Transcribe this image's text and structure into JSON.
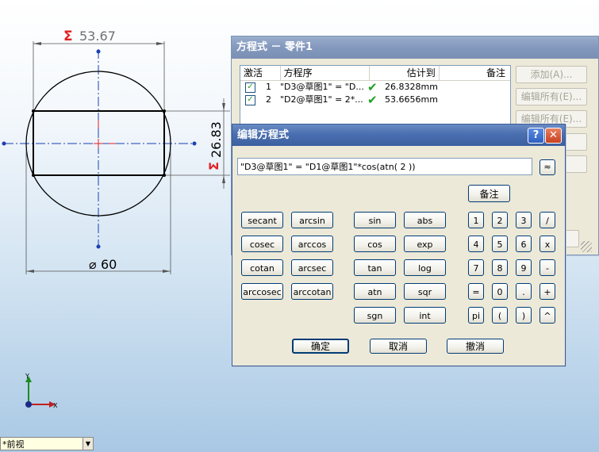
{
  "sketch": {
    "dim_top": "53.67",
    "dim_right": "26.83",
    "dim_bottom": "60",
    "sigma": "Σ",
    "diameter": "⌀"
  },
  "triad": {
    "x_label": "X",
    "y_label": "Y"
  },
  "equations_dialog": {
    "title": "方程式 － 零件1",
    "headers": [
      "激活",
      "方程序",
      "估计到",
      "备注"
    ],
    "rows": [
      {
        "num": "1",
        "equation": "\"D3@草图1\" = \"D...",
        "value": "26.8328mm",
        "active": true
      },
      {
        "num": "2",
        "equation": "\"D2@草图1\" = 2*...",
        "value": "53.6656mm",
        "active": true
      }
    ],
    "buttons": {
      "add": "添加(A)...",
      "edit_all": "编辑所有(E)...",
      "edit_all2": "编辑所有(E)..."
    }
  },
  "edit_dialog": {
    "title": "编辑方程式",
    "help_label": "?",
    "close_label": "✕",
    "expression": "\"D3@草图1\" = \"D1@草图1\"*cos(atn( 2 ))",
    "collapse_label": "≈",
    "note_button": "备注",
    "trig_buttons": [
      "secant",
      "arcsin",
      "cosec",
      "arccos",
      "cotan",
      "arcsec",
      "arccosec",
      "arccotan"
    ],
    "func_buttons": [
      "sin",
      "abs",
      "cos",
      "exp",
      "tan",
      "log",
      "atn",
      "sqr",
      "sgn",
      "int"
    ],
    "keypad": [
      "1",
      "2",
      "3",
      "/",
      "4",
      "5",
      "6",
      "x",
      "7",
      "8",
      "9",
      "-",
      "=",
      "0",
      ".",
      "+",
      "pi",
      "(",
      ")",
      "^"
    ],
    "ok": "确定",
    "cancel": "取消",
    "undo": "撤消"
  },
  "status_bar": {
    "view": "*前视"
  }
}
